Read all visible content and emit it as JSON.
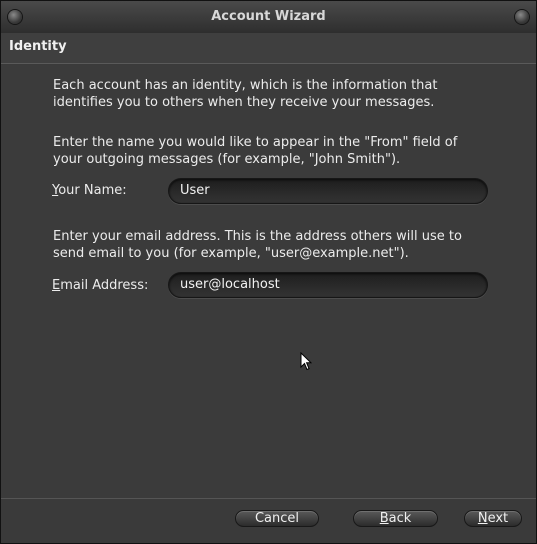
{
  "window": {
    "title": "Account Wizard"
  },
  "page": {
    "heading": "Identity",
    "intro": "Each account has an identity, which is the information that identifies you to others when they receive your messages.",
    "name_instructions": "Enter the name you would like to appear in the \"From\" field of your outgoing messages (for example, \"John Smith\").",
    "email_instructions": "Enter your email address. This is the address others will use to send email to you (for example, \"user@example.net\")."
  },
  "fields": {
    "name": {
      "label_first": "Y",
      "label_rest": "our Name:",
      "value": "User"
    },
    "email": {
      "label_first": "E",
      "label_rest": "mail Address:",
      "value": "user@localhost"
    }
  },
  "buttons": {
    "cancel": "Cancel",
    "back_first": "B",
    "back_rest": "ack",
    "next_first": "N",
    "next_rest": "ext"
  }
}
